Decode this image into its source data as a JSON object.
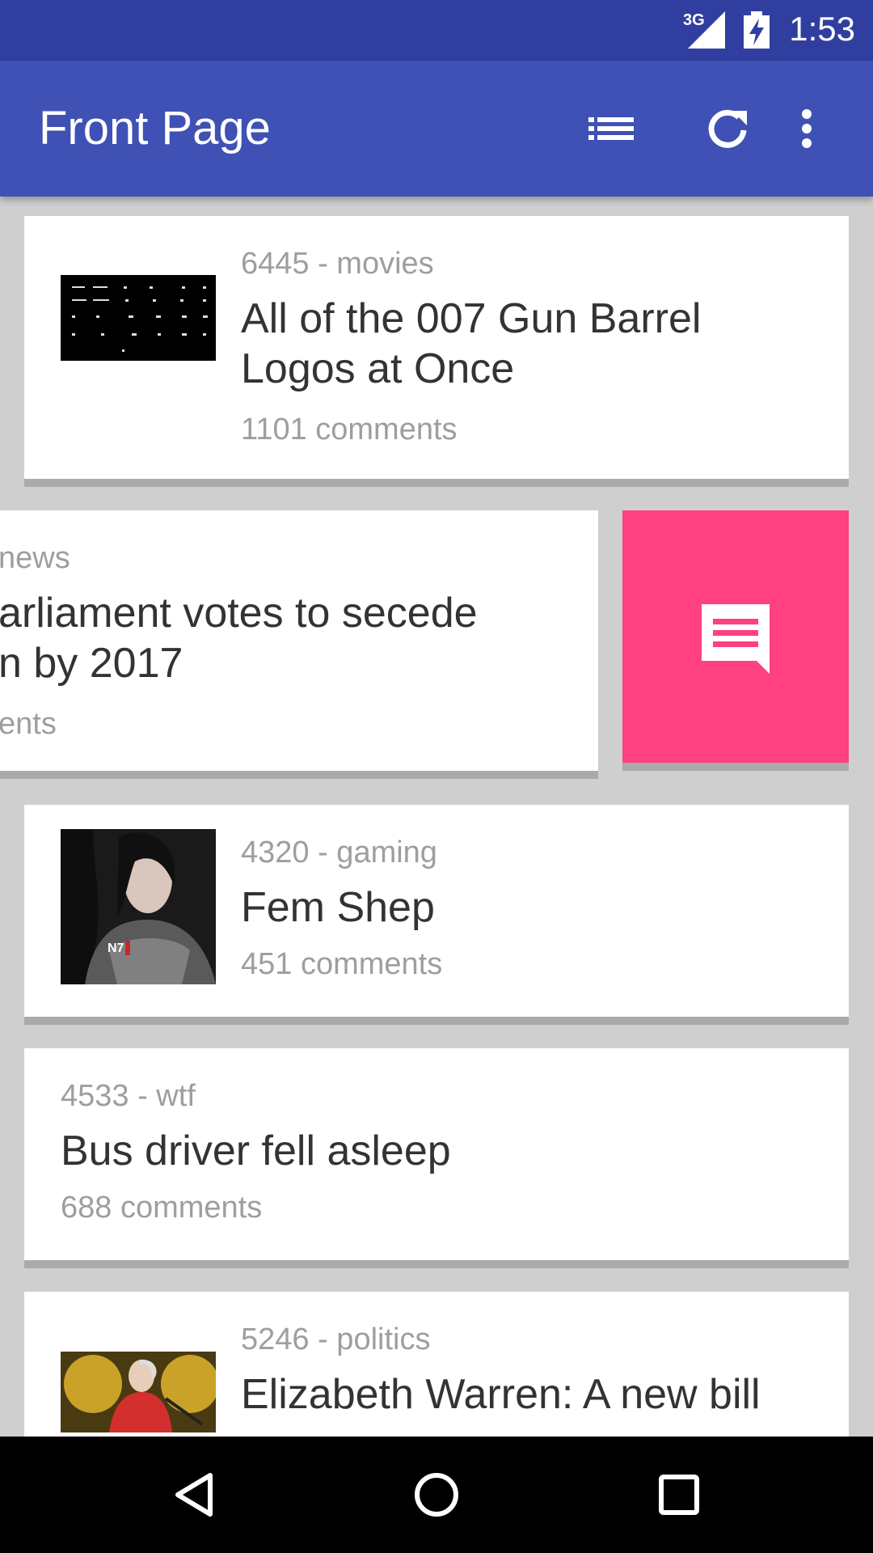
{
  "status_bar": {
    "network": "3G",
    "time": "1:53"
  },
  "app_bar": {
    "title": "Front Page",
    "icons": [
      "list-icon",
      "refresh-icon",
      "more-vert-icon"
    ]
  },
  "posts": [
    {
      "meta": "6445 - movies",
      "title": "All of the 007 Gun Barrel Logos at Once",
      "comments": "1101 comments"
    },
    {
      "meta": "news",
      "title_line1": "arliament votes to secede",
      "title_line2": "n by 2017",
      "comments": "ents"
    },
    {
      "meta": "4320 - gaming",
      "title": "Fem Shep",
      "comments": "451 comments"
    },
    {
      "meta": "4533 - wtf",
      "title": "Bus driver fell asleep",
      "comments": "688 comments"
    },
    {
      "meta": "5246 - politics",
      "title": "Elizabeth Warren: A new bill"
    }
  ],
  "swipe_action": {
    "icon": "comment-icon",
    "color": "#ff4081"
  },
  "colors": {
    "status": "#303f9f",
    "primary": "#3f51b5",
    "accent": "#ff4081"
  },
  "nav_bar": {
    "icons": [
      "back-icon",
      "home-icon",
      "recents-icon"
    ]
  }
}
